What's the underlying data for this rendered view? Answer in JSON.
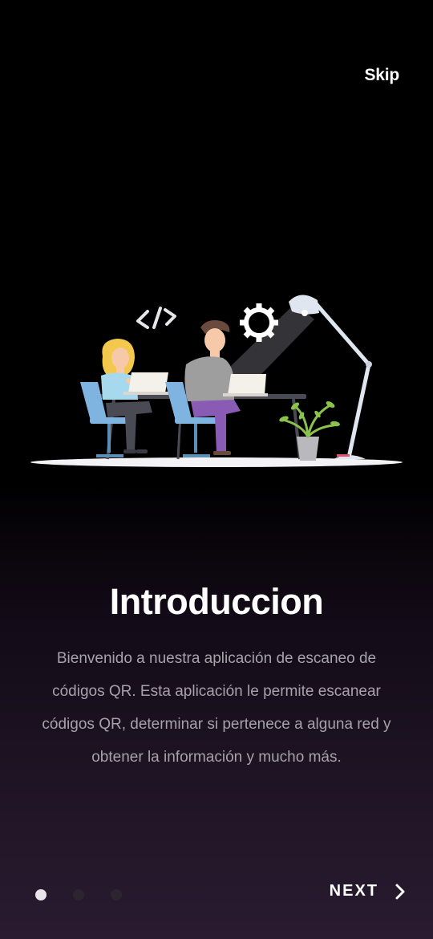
{
  "header": {
    "skip_label": "Skip"
  },
  "intro": {
    "title": "Introduccion",
    "description": "Bienvenido a nuestra aplicación de escaneo de códigos QR. Esta aplicación le permite escanear códigos QR, determinar si pertenece a alguna red y obtener la información y mucho más."
  },
  "pager": {
    "pages": 3,
    "active_index": 0
  },
  "footer": {
    "next_label": "NEXT",
    "next_icon": "chevron-right-icon"
  },
  "colors": {
    "background_top": "#000000",
    "background_bottom": "#2a1b30",
    "dot_active": "#e9e6ea",
    "dot_inactive": "#2c2530",
    "description_text": "#a7a2aa"
  }
}
